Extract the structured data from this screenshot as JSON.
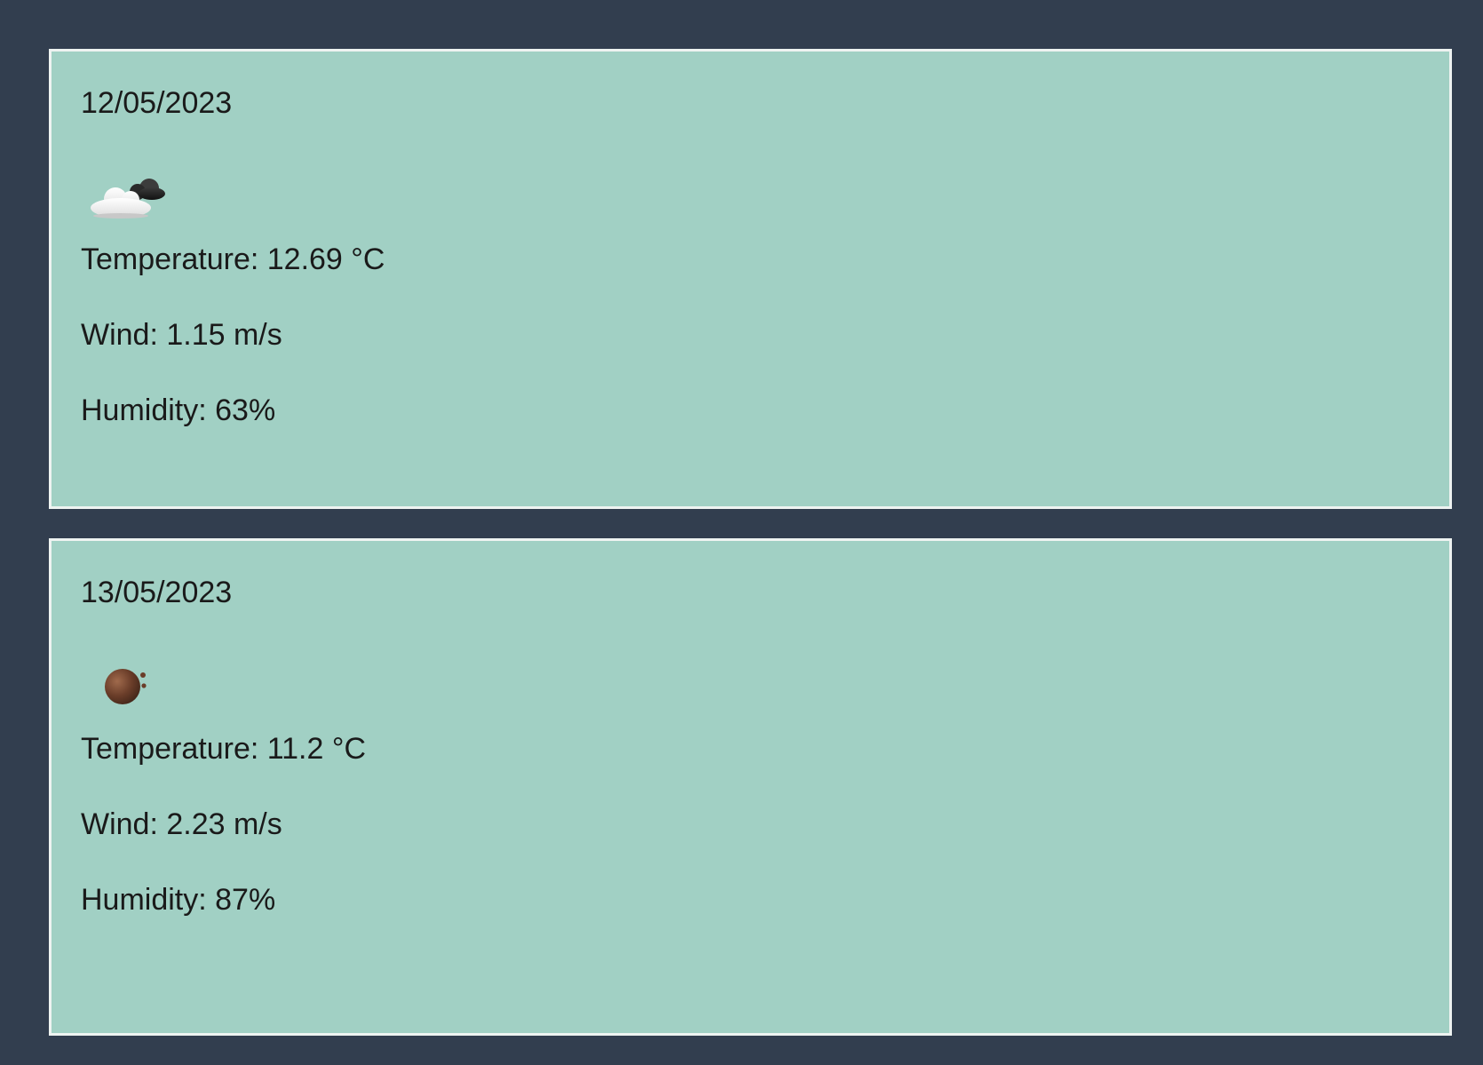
{
  "forecast": [
    {
      "date": "12/05/2023",
      "icon": "partly-cloudy-night-icon",
      "temperature": "Temperature: 12.69 °C",
      "wind": "Wind: 1.15 m/s",
      "humidity": "Humidity: 63%"
    },
    {
      "date": "13/05/2023",
      "icon": "dark-round-weather-icon",
      "temperature": "Temperature: 11.2 °C",
      "wind": "Wind: 2.23 m/s",
      "humidity": "Humidity: 87%"
    }
  ],
  "colors": {
    "page_background": "#323e4f",
    "card_background": "#a1d0c4",
    "card_border": "#eef3f1",
    "text": "#1a1a1a"
  }
}
